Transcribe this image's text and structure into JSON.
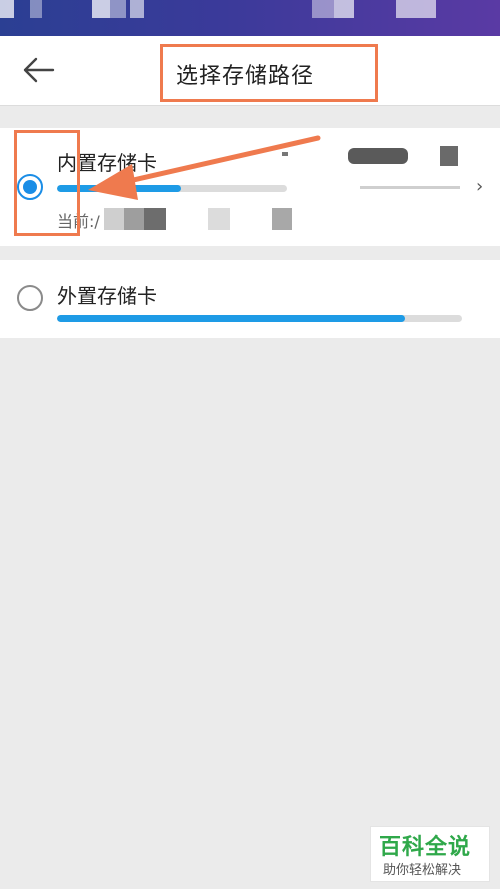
{
  "status_bar": {},
  "header": {
    "title": "选择存储路径",
    "back_icon": "back-arrow-icon"
  },
  "storage_options": [
    {
      "label": "内置存储卡",
      "selected": true,
      "usage_fraction": 0.54,
      "current_prefix": "当前:/"
    },
    {
      "label": "外置存储卡",
      "selected": false,
      "usage_fraction": 0.86
    }
  ],
  "watermark": {
    "title": "百科全说",
    "subtitle": "助你轻松解决"
  },
  "colors": {
    "accent_blue": "#1e9be6",
    "annotation_orange": "#ef7a4e",
    "watermark_green": "#2fa84a"
  }
}
